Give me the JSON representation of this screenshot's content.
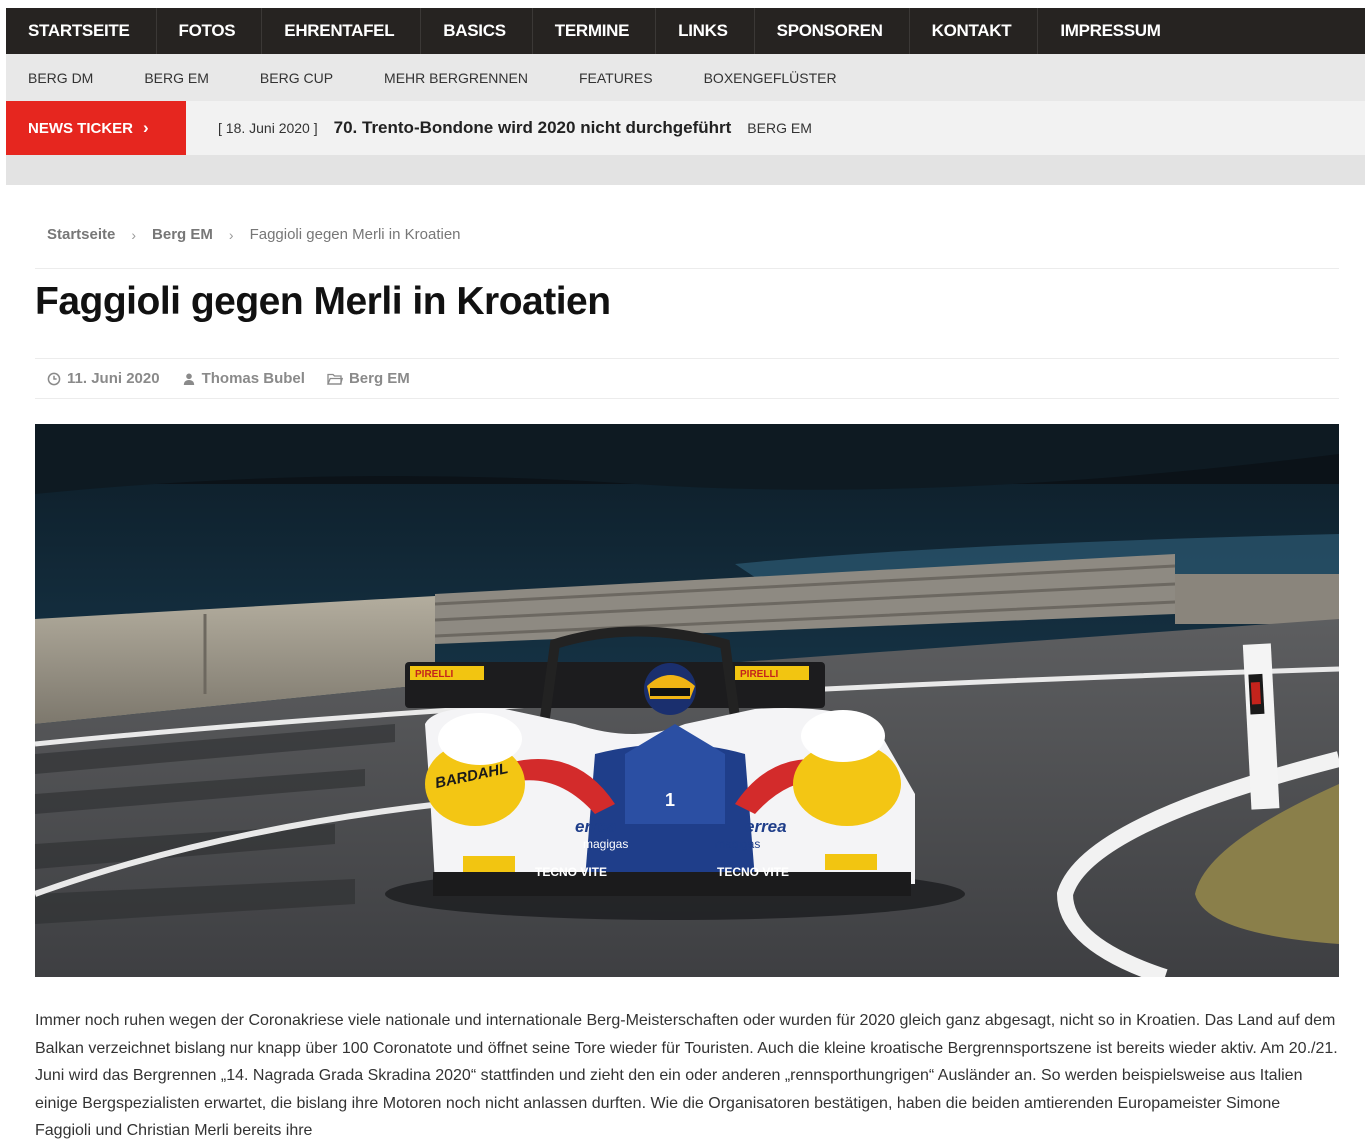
{
  "main_nav": {
    "items": [
      "STARTSEITE",
      "FOTOS",
      "EHRENTAFEL",
      "BASICS",
      "TERMINE",
      "LINKS",
      "SPONSOREN",
      "KONTAKT",
      "IMPRESSUM"
    ]
  },
  "sub_nav": {
    "items": [
      "BERG DM",
      "BERG EM",
      "BERG CUP",
      "MEHR BERGRENNEN",
      "FEATURES",
      "BOXENGEFLÜSTER"
    ]
  },
  "ticker": {
    "label": "NEWS TICKER",
    "chevron": "›",
    "date": "[ 18. Juni 2020 ]",
    "headline": "70. Trento-Bondone wird 2020 nicht durchgeführt",
    "category": "BERG EM"
  },
  "breadcrumb": {
    "items": [
      "Startseite",
      "Berg EM",
      "Faggioli gegen Merli in Kroatien"
    ],
    "separator": "›"
  },
  "article": {
    "title": "Faggioli gegen Merli in Kroatien",
    "date": "11. Juni 2020",
    "author": "Thomas Bubel",
    "category": "Berg EM",
    "hero_image_text": {
      "car_number": "1",
      "sponsor_errea": "errea",
      "sponsor_magigas": "magigas",
      "sponsor_tecnovite": "TECNO VITE",
      "sponsor_bardahl": "BARDAHL",
      "sponsor_pirelli": "PIRELLI"
    },
    "body_text": "Immer noch ruhen wegen der Coronakriese viele nationale und internationale Berg-Meisterschaften oder wurden für 2020 gleich ganz abgesagt, nicht so in Kroatien. Das Land auf dem Balkan verzeichnet bislang nur knapp über 100 Coronatote und öffnet seine Tore wieder für Touristen. Auch die kleine kroatische Bergrennsportszene ist bereits wieder aktiv. Am 20./21. Juni wird das Bergrennen „14. Nagrada Grada Skradina 2020“ stattfinden und zieht den ein oder anderen „rennsporthungrigen“ Ausländer an. So werden beispielsweise aus Italien einige Bergspezialisten erwartet, die bislang ihre Motoren noch nicht anlassen durften. Wie die Organisatoren bestätigen, haben die beiden amtierenden Europameister Simone Faggioli und Christian Merli bereits ihre"
  },
  "colors": {
    "nav_bg": "#262321",
    "subnav_bg": "#e8e8e8",
    "ticker_accent": "#e6261f",
    "text_dark": "#111111"
  },
  "icons": {
    "date": "clock-icon",
    "author": "user-icon",
    "category": "folder-icon"
  }
}
